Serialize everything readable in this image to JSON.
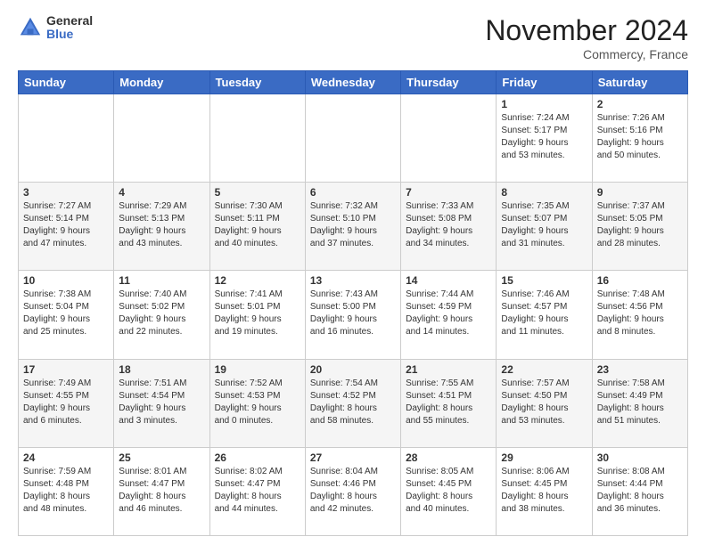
{
  "logo": {
    "text_top": "General",
    "text_bottom": "Blue"
  },
  "header": {
    "month": "November 2024",
    "location": "Commercy, France"
  },
  "weekdays": [
    "Sunday",
    "Monday",
    "Tuesday",
    "Wednesday",
    "Thursday",
    "Friday",
    "Saturday"
  ],
  "weeks": [
    [
      {
        "day": "",
        "info": ""
      },
      {
        "day": "",
        "info": ""
      },
      {
        "day": "",
        "info": ""
      },
      {
        "day": "",
        "info": ""
      },
      {
        "day": "",
        "info": ""
      },
      {
        "day": "1",
        "info": "Sunrise: 7:24 AM\nSunset: 5:17 PM\nDaylight: 9 hours\nand 53 minutes."
      },
      {
        "day": "2",
        "info": "Sunrise: 7:26 AM\nSunset: 5:16 PM\nDaylight: 9 hours\nand 50 minutes."
      }
    ],
    [
      {
        "day": "3",
        "info": "Sunrise: 7:27 AM\nSunset: 5:14 PM\nDaylight: 9 hours\nand 47 minutes."
      },
      {
        "day": "4",
        "info": "Sunrise: 7:29 AM\nSunset: 5:13 PM\nDaylight: 9 hours\nand 43 minutes."
      },
      {
        "day": "5",
        "info": "Sunrise: 7:30 AM\nSunset: 5:11 PM\nDaylight: 9 hours\nand 40 minutes."
      },
      {
        "day": "6",
        "info": "Sunrise: 7:32 AM\nSunset: 5:10 PM\nDaylight: 9 hours\nand 37 minutes."
      },
      {
        "day": "7",
        "info": "Sunrise: 7:33 AM\nSunset: 5:08 PM\nDaylight: 9 hours\nand 34 minutes."
      },
      {
        "day": "8",
        "info": "Sunrise: 7:35 AM\nSunset: 5:07 PM\nDaylight: 9 hours\nand 31 minutes."
      },
      {
        "day": "9",
        "info": "Sunrise: 7:37 AM\nSunset: 5:05 PM\nDaylight: 9 hours\nand 28 minutes."
      }
    ],
    [
      {
        "day": "10",
        "info": "Sunrise: 7:38 AM\nSunset: 5:04 PM\nDaylight: 9 hours\nand 25 minutes."
      },
      {
        "day": "11",
        "info": "Sunrise: 7:40 AM\nSunset: 5:02 PM\nDaylight: 9 hours\nand 22 minutes."
      },
      {
        "day": "12",
        "info": "Sunrise: 7:41 AM\nSunset: 5:01 PM\nDaylight: 9 hours\nand 19 minutes."
      },
      {
        "day": "13",
        "info": "Sunrise: 7:43 AM\nSunset: 5:00 PM\nDaylight: 9 hours\nand 16 minutes."
      },
      {
        "day": "14",
        "info": "Sunrise: 7:44 AM\nSunset: 4:59 PM\nDaylight: 9 hours\nand 14 minutes."
      },
      {
        "day": "15",
        "info": "Sunrise: 7:46 AM\nSunset: 4:57 PM\nDaylight: 9 hours\nand 11 minutes."
      },
      {
        "day": "16",
        "info": "Sunrise: 7:48 AM\nSunset: 4:56 PM\nDaylight: 9 hours\nand 8 minutes."
      }
    ],
    [
      {
        "day": "17",
        "info": "Sunrise: 7:49 AM\nSunset: 4:55 PM\nDaylight: 9 hours\nand 6 minutes."
      },
      {
        "day": "18",
        "info": "Sunrise: 7:51 AM\nSunset: 4:54 PM\nDaylight: 9 hours\nand 3 minutes."
      },
      {
        "day": "19",
        "info": "Sunrise: 7:52 AM\nSunset: 4:53 PM\nDaylight: 9 hours\nand 0 minutes."
      },
      {
        "day": "20",
        "info": "Sunrise: 7:54 AM\nSunset: 4:52 PM\nDaylight: 8 hours\nand 58 minutes."
      },
      {
        "day": "21",
        "info": "Sunrise: 7:55 AM\nSunset: 4:51 PM\nDaylight: 8 hours\nand 55 minutes."
      },
      {
        "day": "22",
        "info": "Sunrise: 7:57 AM\nSunset: 4:50 PM\nDaylight: 8 hours\nand 53 minutes."
      },
      {
        "day": "23",
        "info": "Sunrise: 7:58 AM\nSunset: 4:49 PM\nDaylight: 8 hours\nand 51 minutes."
      }
    ],
    [
      {
        "day": "24",
        "info": "Sunrise: 7:59 AM\nSunset: 4:48 PM\nDaylight: 8 hours\nand 48 minutes."
      },
      {
        "day": "25",
        "info": "Sunrise: 8:01 AM\nSunset: 4:47 PM\nDaylight: 8 hours\nand 46 minutes."
      },
      {
        "day": "26",
        "info": "Sunrise: 8:02 AM\nSunset: 4:47 PM\nDaylight: 8 hours\nand 44 minutes."
      },
      {
        "day": "27",
        "info": "Sunrise: 8:04 AM\nSunset: 4:46 PM\nDaylight: 8 hours\nand 42 minutes."
      },
      {
        "day": "28",
        "info": "Sunrise: 8:05 AM\nSunset: 4:45 PM\nDaylight: 8 hours\nand 40 minutes."
      },
      {
        "day": "29",
        "info": "Sunrise: 8:06 AM\nSunset: 4:45 PM\nDaylight: 8 hours\nand 38 minutes."
      },
      {
        "day": "30",
        "info": "Sunrise: 8:08 AM\nSunset: 4:44 PM\nDaylight: 8 hours\nand 36 minutes."
      }
    ]
  ]
}
